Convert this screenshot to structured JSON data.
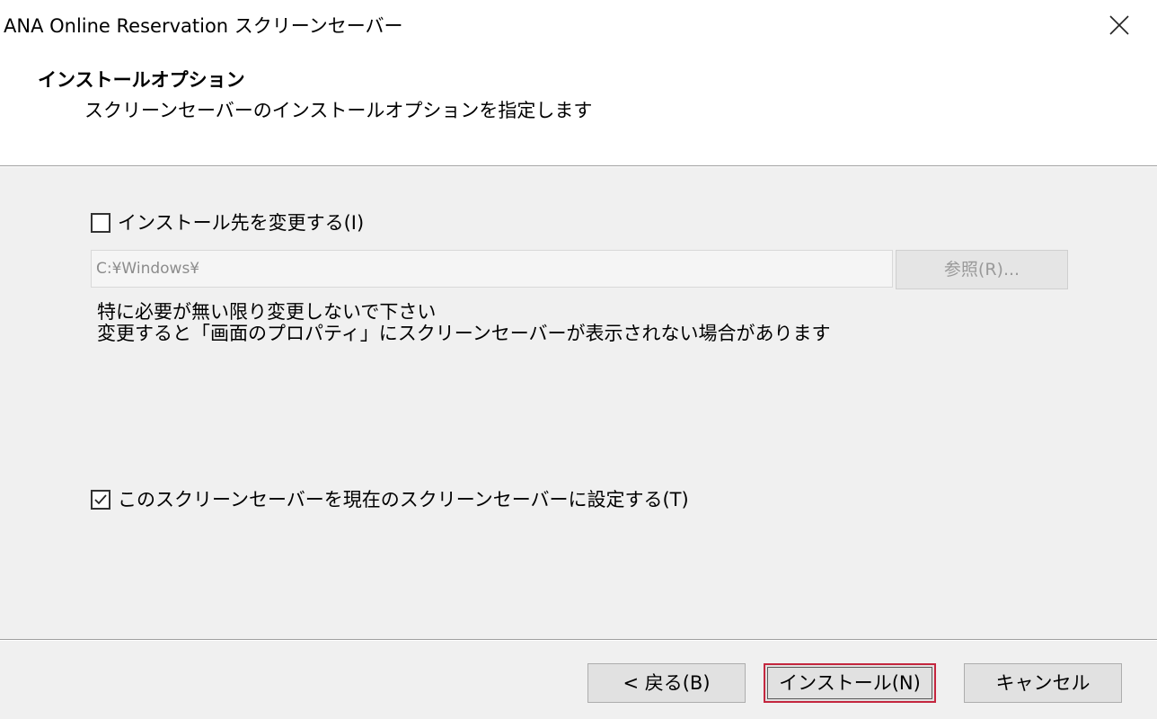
{
  "window": {
    "title": "ANA Online Reservation スクリーンセーバー",
    "close_icon": "close-icon"
  },
  "header": {
    "title": "インストールオプション",
    "subtitle": "スクリーンセーバーのインストールオプションを指定します"
  },
  "options": {
    "change_dest": {
      "label": "インストール先を変更する(I)",
      "checked": false
    },
    "install_path": {
      "value": "C:¥Windows¥",
      "enabled": false
    },
    "browse_label": "参照(R)...",
    "note_line1": "特に必要が無い限り変更しないで下さい",
    "note_line2": "変更すると「画面のプロパティ」にスクリーンセーバーが表示されない場合があります",
    "set_current": {
      "label": "このスクリーンセーバーを現在のスクリーンセーバーに設定する(T)",
      "checked": true
    }
  },
  "footer": {
    "back_label": "< 戻る(B)",
    "install_label": "インストール(N)",
    "cancel_label": "キャンセル"
  },
  "colors": {
    "default_button_border": "#c4273f",
    "dialog_background": "#f0f0f0"
  }
}
